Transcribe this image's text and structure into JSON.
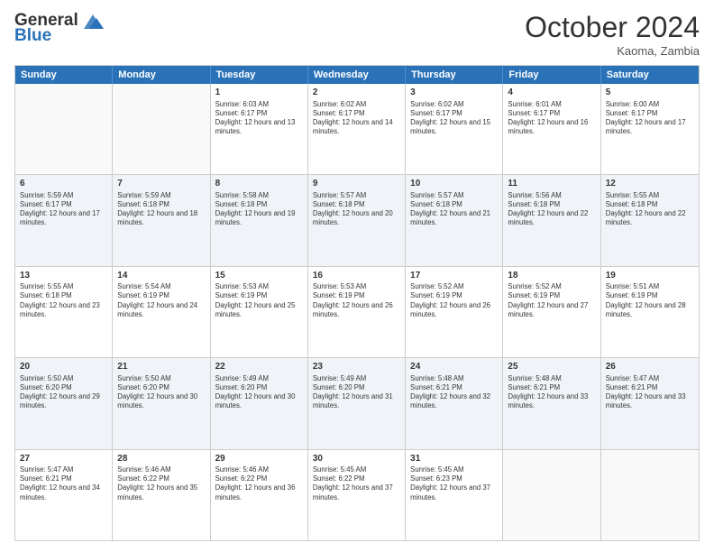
{
  "header": {
    "logo_line1": "General",
    "logo_line2": "Blue",
    "month": "October 2024",
    "location": "Kaoma, Zambia"
  },
  "days_of_week": [
    "Sunday",
    "Monday",
    "Tuesday",
    "Wednesday",
    "Thursday",
    "Friday",
    "Saturday"
  ],
  "weeks": [
    [
      {
        "day": "",
        "info": "",
        "empty": true
      },
      {
        "day": "",
        "info": "",
        "empty": true
      },
      {
        "day": "1",
        "info": "Sunrise: 6:03 AM\nSunset: 6:17 PM\nDaylight: 12 hours and 13 minutes."
      },
      {
        "day": "2",
        "info": "Sunrise: 6:02 AM\nSunset: 6:17 PM\nDaylight: 12 hours and 14 minutes."
      },
      {
        "day": "3",
        "info": "Sunrise: 6:02 AM\nSunset: 6:17 PM\nDaylight: 12 hours and 15 minutes."
      },
      {
        "day": "4",
        "info": "Sunrise: 6:01 AM\nSunset: 6:17 PM\nDaylight: 12 hours and 16 minutes."
      },
      {
        "day": "5",
        "info": "Sunrise: 6:00 AM\nSunset: 6:17 PM\nDaylight: 12 hours and 17 minutes."
      }
    ],
    [
      {
        "day": "6",
        "info": "Sunrise: 5:59 AM\nSunset: 6:17 PM\nDaylight: 12 hours and 17 minutes."
      },
      {
        "day": "7",
        "info": "Sunrise: 5:59 AM\nSunset: 6:18 PM\nDaylight: 12 hours and 18 minutes."
      },
      {
        "day": "8",
        "info": "Sunrise: 5:58 AM\nSunset: 6:18 PM\nDaylight: 12 hours and 19 minutes."
      },
      {
        "day": "9",
        "info": "Sunrise: 5:57 AM\nSunset: 6:18 PM\nDaylight: 12 hours and 20 minutes."
      },
      {
        "day": "10",
        "info": "Sunrise: 5:57 AM\nSunset: 6:18 PM\nDaylight: 12 hours and 21 minutes."
      },
      {
        "day": "11",
        "info": "Sunrise: 5:56 AM\nSunset: 6:18 PM\nDaylight: 12 hours and 22 minutes."
      },
      {
        "day": "12",
        "info": "Sunrise: 5:55 AM\nSunset: 6:18 PM\nDaylight: 12 hours and 22 minutes."
      }
    ],
    [
      {
        "day": "13",
        "info": "Sunrise: 5:55 AM\nSunset: 6:18 PM\nDaylight: 12 hours and 23 minutes."
      },
      {
        "day": "14",
        "info": "Sunrise: 5:54 AM\nSunset: 6:19 PM\nDaylight: 12 hours and 24 minutes."
      },
      {
        "day": "15",
        "info": "Sunrise: 5:53 AM\nSunset: 6:19 PM\nDaylight: 12 hours and 25 minutes."
      },
      {
        "day": "16",
        "info": "Sunrise: 5:53 AM\nSunset: 6:19 PM\nDaylight: 12 hours and 26 minutes."
      },
      {
        "day": "17",
        "info": "Sunrise: 5:52 AM\nSunset: 6:19 PM\nDaylight: 12 hours and 26 minutes."
      },
      {
        "day": "18",
        "info": "Sunrise: 5:52 AM\nSunset: 6:19 PM\nDaylight: 12 hours and 27 minutes."
      },
      {
        "day": "19",
        "info": "Sunrise: 5:51 AM\nSunset: 6:19 PM\nDaylight: 12 hours and 28 minutes."
      }
    ],
    [
      {
        "day": "20",
        "info": "Sunrise: 5:50 AM\nSunset: 6:20 PM\nDaylight: 12 hours and 29 minutes."
      },
      {
        "day": "21",
        "info": "Sunrise: 5:50 AM\nSunset: 6:20 PM\nDaylight: 12 hours and 30 minutes."
      },
      {
        "day": "22",
        "info": "Sunrise: 5:49 AM\nSunset: 6:20 PM\nDaylight: 12 hours and 30 minutes."
      },
      {
        "day": "23",
        "info": "Sunrise: 5:49 AM\nSunset: 6:20 PM\nDaylight: 12 hours and 31 minutes."
      },
      {
        "day": "24",
        "info": "Sunrise: 5:48 AM\nSunset: 6:21 PM\nDaylight: 12 hours and 32 minutes."
      },
      {
        "day": "25",
        "info": "Sunrise: 5:48 AM\nSunset: 6:21 PM\nDaylight: 12 hours and 33 minutes."
      },
      {
        "day": "26",
        "info": "Sunrise: 5:47 AM\nSunset: 6:21 PM\nDaylight: 12 hours and 33 minutes."
      }
    ],
    [
      {
        "day": "27",
        "info": "Sunrise: 5:47 AM\nSunset: 6:21 PM\nDaylight: 12 hours and 34 minutes."
      },
      {
        "day": "28",
        "info": "Sunrise: 5:46 AM\nSunset: 6:22 PM\nDaylight: 12 hours and 35 minutes."
      },
      {
        "day": "29",
        "info": "Sunrise: 5:46 AM\nSunset: 6:22 PM\nDaylight: 12 hours and 36 minutes."
      },
      {
        "day": "30",
        "info": "Sunrise: 5:45 AM\nSunset: 6:22 PM\nDaylight: 12 hours and 37 minutes."
      },
      {
        "day": "31",
        "info": "Sunrise: 5:45 AM\nSunset: 6:23 PM\nDaylight: 12 hours and 37 minutes."
      },
      {
        "day": "",
        "info": "",
        "empty": true
      },
      {
        "day": "",
        "info": "",
        "empty": true
      }
    ]
  ]
}
